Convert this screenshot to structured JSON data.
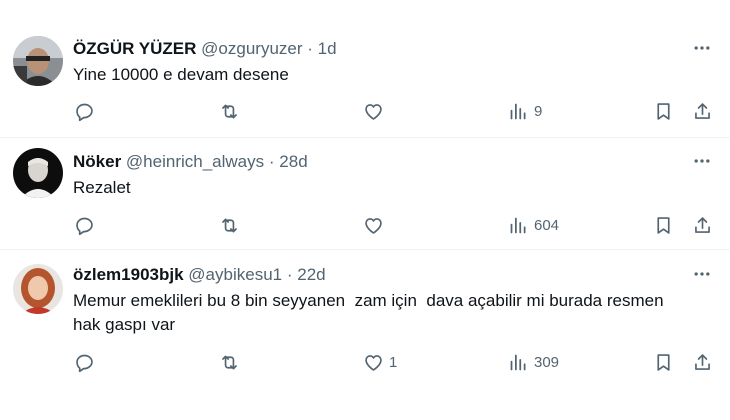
{
  "tweets": [
    {
      "name": "ÖZGÜR YÜZER",
      "handle": "@ozguryuzer",
      "sep": "·",
      "time": "1d",
      "text": "Yine 10000 e devam desene",
      "replies": "",
      "reposts": "",
      "likes": "",
      "views": "9"
    },
    {
      "name": "Nöker",
      "handle": "@heinrich_always",
      "sep": "·",
      "time": "28d",
      "text": "Rezalet",
      "replies": "",
      "reposts": "",
      "likes": "",
      "views": "604"
    },
    {
      "name": "özlem1903bjk",
      "handle": "@aybikesu1",
      "sep": "·",
      "time": "22d",
      "text": "Memur emeklileri bu 8 bin seyyanen  zam için  dava açabilir mi burada resmen hak gaspı var",
      "replies": "",
      "reposts": "",
      "likes": "1",
      "views": "309"
    }
  ],
  "icons": {
    "reply": "reply-icon",
    "repost": "repost-icon",
    "like": "heart-icon",
    "views": "views-chart-icon",
    "bookmark": "bookmark-icon",
    "share": "share-icon",
    "more": "more-dots-icon"
  },
  "colors": {
    "text": "#0f1419",
    "secondary": "#536471",
    "divider": "#eff3f4"
  }
}
